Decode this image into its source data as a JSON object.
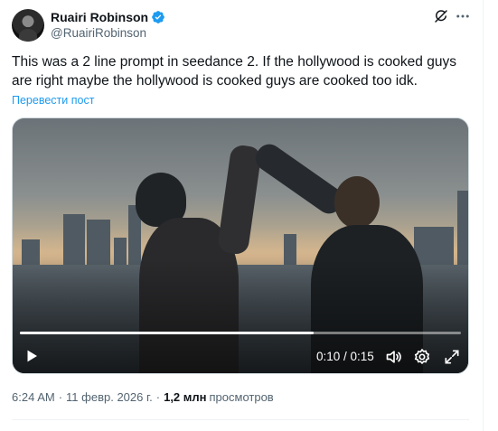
{
  "author": {
    "display_name": "Ruairi Robinson",
    "handle": "@RuairiRobinson",
    "verified": true
  },
  "tweet": {
    "text": "This was a 2 line prompt in seedance 2. If the hollywood is cooked guys are right maybe the hollywood is cooked guys are cooked too idk.",
    "translate_label": "Перевести пост"
  },
  "video": {
    "current_time": "0:10",
    "duration": "0:15",
    "time_display": "0:10 / 0:15",
    "progress_fraction": 0.667
  },
  "meta": {
    "time": "6:24 AM",
    "separator": "·",
    "date": "11 февр. 2026 г.",
    "separator2": "·",
    "views_count": "1,2 млн",
    "views_label": "просмотров"
  },
  "colors": {
    "accent": "#1d9bf0",
    "text_primary": "#0f1419",
    "text_secondary": "#536471"
  },
  "icons": {
    "verified": "verified-badge-icon",
    "grok": "grok-icon",
    "more": "more-icon",
    "play": "play-icon",
    "volume": "volume-icon",
    "settings": "settings-icon",
    "fullscreen": "fullscreen-icon"
  }
}
